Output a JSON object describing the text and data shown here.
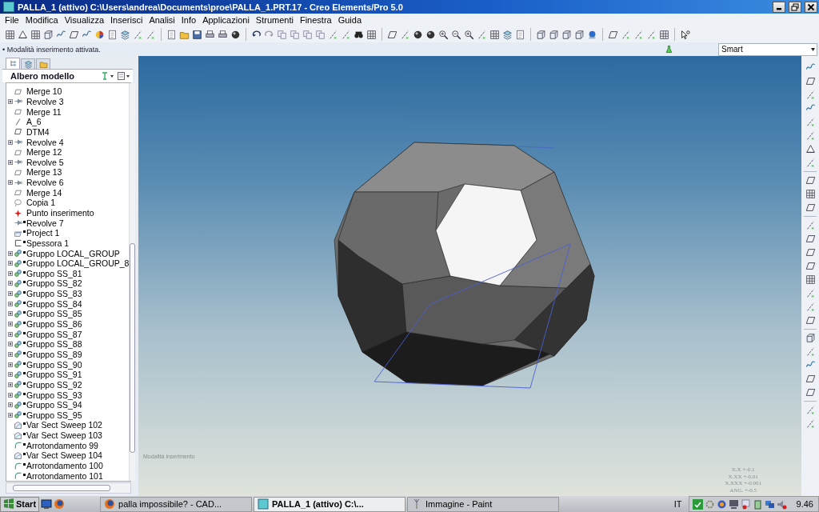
{
  "window": {
    "title": "PALLA_1 (attivo) C:\\Users\\andrea\\Documents\\proe\\PALLA_1.PRT.17 - Creo Elements/Pro 5.0"
  },
  "menu": [
    "File",
    "Modifica",
    "Visualizza",
    "Inserisci",
    "Analisi",
    "Info",
    "Applicazioni",
    "Strumenti",
    "Finestra",
    "Guida"
  ],
  "message": "• Modalità inserimento attivata.",
  "filter": {
    "value": "Smart"
  },
  "panel_tabs": [
    {
      "kind": "tree",
      "selected": true
    },
    {
      "kind": "layers",
      "selected": false
    },
    {
      "kind": "folder",
      "selected": false
    }
  ],
  "tree": {
    "title": "Albero modello",
    "items": [
      {
        "label": "Merge 10",
        "kind": "merge",
        "expandable": false,
        "marked": false
      },
      {
        "label": "Revolve 3",
        "kind": "revolve",
        "expandable": true,
        "marked": false
      },
      {
        "label": "Merge 11",
        "kind": "merge",
        "expandable": false,
        "marked": false
      },
      {
        "label": "A_6",
        "kind": "axis",
        "expandable": false,
        "marked": false
      },
      {
        "label": "DTM4",
        "kind": "plane",
        "expandable": false,
        "marked": false
      },
      {
        "label": "Revolve 4",
        "kind": "revolve",
        "expandable": true,
        "marked": false
      },
      {
        "label": "Merge 12",
        "kind": "merge",
        "expandable": false,
        "marked": false
      },
      {
        "label": "Revolve 5",
        "kind": "revolve",
        "expandable": true,
        "marked": false
      },
      {
        "label": "Merge 13",
        "kind": "merge",
        "expandable": false,
        "marked": false
      },
      {
        "label": "Revolve 6",
        "kind": "revolve",
        "expandable": true,
        "marked": false
      },
      {
        "label": "Merge 14",
        "kind": "merge",
        "expandable": false,
        "marked": false
      },
      {
        "label": "Copia 1",
        "kind": "copy",
        "expandable": false,
        "marked": false
      },
      {
        "label": "Punto inserimento",
        "kind": "insert",
        "expandable": false,
        "marked": false
      },
      {
        "label": "Revolve 7",
        "kind": "revolve",
        "expandable": false,
        "marked": true
      },
      {
        "label": "Project 1",
        "kind": "project",
        "expandable": false,
        "marked": true
      },
      {
        "label": "Spessora 1",
        "kind": "shell",
        "expandable": false,
        "marked": true
      },
      {
        "label": "Gruppo LOCAL_GROUP",
        "kind": "group",
        "expandable": true,
        "marked": true
      },
      {
        "label": "Gruppo LOCAL_GROUP_8",
        "kind": "group",
        "expandable": true,
        "marked": true
      },
      {
        "label": "Gruppo SS_81",
        "kind": "group",
        "expandable": true,
        "marked": true
      },
      {
        "label": "Gruppo SS_82",
        "kind": "group",
        "expandable": true,
        "marked": true
      },
      {
        "label": "Gruppo SS_83",
        "kind": "group",
        "expandable": true,
        "marked": true
      },
      {
        "label": "Gruppo SS_84",
        "kind": "group",
        "expandable": true,
        "marked": true
      },
      {
        "label": "Gruppo SS_85",
        "kind": "group",
        "expandable": true,
        "marked": true
      },
      {
        "label": "Gruppo SS_86",
        "kind": "group",
        "expandable": true,
        "marked": true
      },
      {
        "label": "Gruppo SS_87",
        "kind": "group",
        "expandable": true,
        "marked": true
      },
      {
        "label": "Gruppo SS_88",
        "kind": "group",
        "expandable": true,
        "marked": true
      },
      {
        "label": "Gruppo SS_89",
        "kind": "group",
        "expandable": true,
        "marked": true
      },
      {
        "label": "Gruppo SS_90",
        "kind": "group",
        "expandable": true,
        "marked": true
      },
      {
        "label": "Gruppo SS_91",
        "kind": "group",
        "expandable": true,
        "marked": true
      },
      {
        "label": "Gruppo SS_92",
        "kind": "group",
        "expandable": true,
        "marked": true
      },
      {
        "label": "Gruppo SS_93",
        "kind": "group",
        "expandable": true,
        "marked": true
      },
      {
        "label": "Gruppo SS_94",
        "kind": "group",
        "expandable": true,
        "marked": true
      },
      {
        "label": "Gruppo SS_95",
        "kind": "group",
        "expandable": true,
        "marked": true
      },
      {
        "label": "Var Sect Sweep 102",
        "kind": "sweep",
        "expandable": false,
        "marked": true
      },
      {
        "label": "Var Sect Sweep 103",
        "kind": "sweep",
        "expandable": false,
        "marked": true
      },
      {
        "label": "Arrotondamento 99",
        "kind": "round",
        "expandable": false,
        "marked": true
      },
      {
        "label": "Var Sect Sweep 104",
        "kind": "sweep",
        "expandable": false,
        "marked": true
      },
      {
        "label": "Arrotondamento 100",
        "kind": "round",
        "expandable": false,
        "marked": true
      },
      {
        "label": "Arrotondamento 101",
        "kind": "round",
        "expandable": false,
        "marked": true
      }
    ]
  },
  "viewport": {
    "mode_label": "Modalità inserimento",
    "tolerances": [
      "X.X +-0.1",
      "X.XX +-0.01",
      "X.XXX +-0.001",
      "ANG. +-0.5"
    ]
  },
  "taskbar": {
    "start": "Start",
    "tasks": [
      {
        "label": "palla impossibile? - CAD...",
        "kind": "browser",
        "selected": false
      },
      {
        "label": "PALLA_1 (attivo) C:\\...",
        "kind": "cad",
        "selected": true
      },
      {
        "label": "Immagine - Paint",
        "kind": "paint",
        "selected": false
      }
    ],
    "language": "IT",
    "clock": "9.46"
  }
}
